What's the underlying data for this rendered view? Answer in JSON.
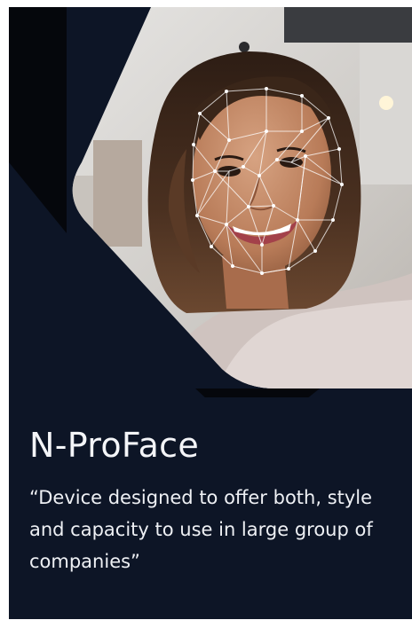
{
  "product": {
    "title": "N-ProFace",
    "tagline": "“Device designed to offer both, style and capacity to use in large group of companies”"
  },
  "image": {
    "subject": "smiling woman with facial recognition mesh overlay"
  },
  "colors": {
    "background": "#0d1526",
    "accent_black": "#05070c",
    "text": "#f4f5f8",
    "mesh": "#ffffff"
  }
}
